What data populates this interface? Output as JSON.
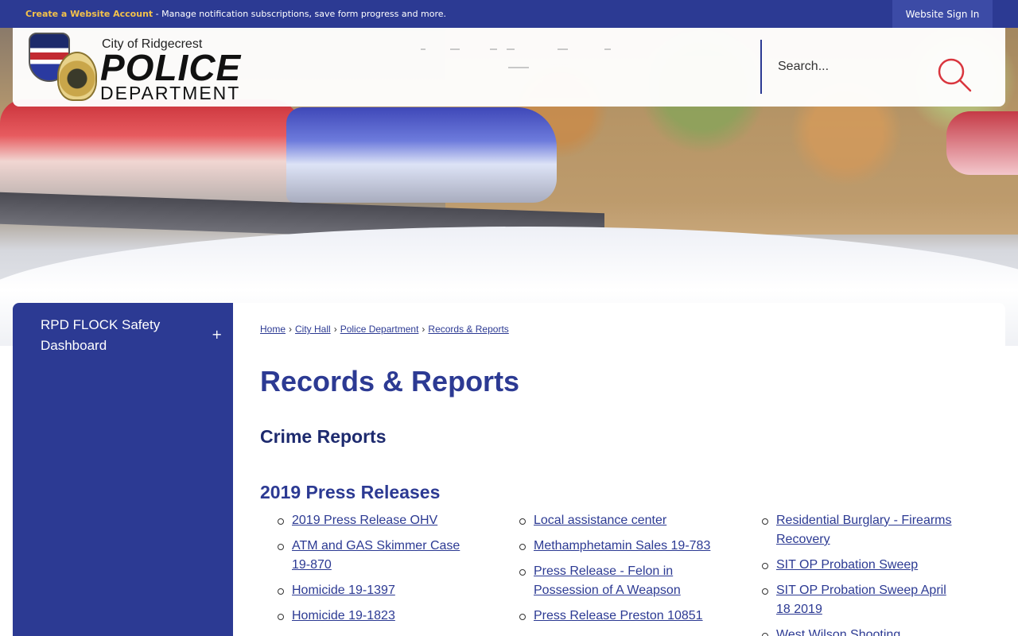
{
  "topbar": {
    "create_account_link": "Create a Website Account",
    "message": " - Manage notification subscriptions, save form progress and more.",
    "sign_in": "Website Sign In"
  },
  "logo": {
    "city": "City of Ridgecrest",
    "police": "POLICE",
    "department": "DEPARTMENT"
  },
  "search": {
    "placeholder": "Search..."
  },
  "sidebar": {
    "items": [
      {
        "label": "RPD FLOCK Safety Dashboard",
        "expand": "+"
      }
    ]
  },
  "breadcrumb": [
    "Home",
    "City Hall",
    "Police Department",
    "Records & Reports"
  ],
  "breadcrumb_sep": "›",
  "page_title": "Records & Reports",
  "sections": {
    "crime_reports": "Crime Reports",
    "press_2019": "2019 Press Releases"
  },
  "press_releases": {
    "col1": [
      "2019 Press Release OHV",
      "ATM and GAS Skimmer Case 19-870",
      "Homicide 19-1397",
      "Homicide 19-1823"
    ],
    "col2": [
      "Local assistance center",
      "Methamphetamin Sales 19-783",
      "Press Release - Felon in Possession of A Weapson",
      "Press Release Preston 10851"
    ],
    "col3": [
      "Residential Burglary - Firearms Recovery",
      "SIT OP Probation Sweep",
      "SIT OP Probation Sweep April 18 2019",
      "West Wilson Shooting"
    ]
  },
  "colors": {
    "brand_blue": "#2c3a93",
    "accent_gold": "#f4c24a",
    "search_icon": "#d9363e"
  },
  "icons": {
    "search": "search-icon",
    "expand": "plus-icon"
  }
}
